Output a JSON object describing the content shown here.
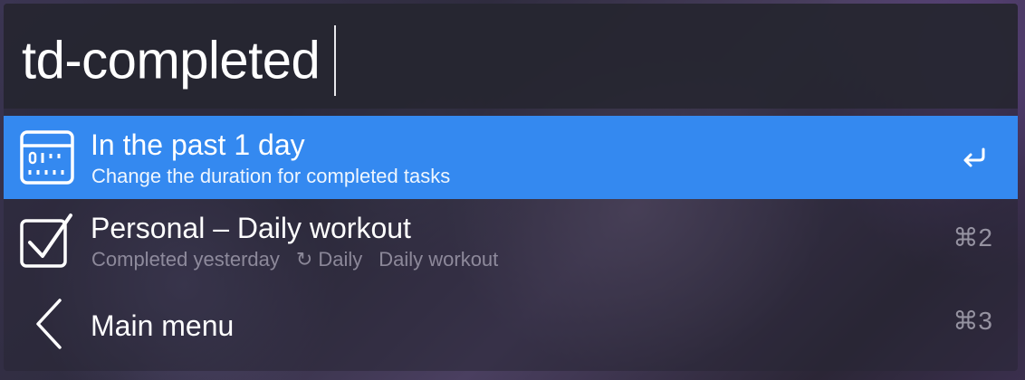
{
  "search": {
    "query": "td-completed"
  },
  "results": [
    {
      "title": "In the past 1 day",
      "subtitle": "Change the duration for completed tasks",
      "icon": "calendar-icon",
      "action": "enter-key-icon",
      "selected": true
    },
    {
      "title": "Personal – Daily workout",
      "meta": {
        "completed": "Completed yesterday",
        "recurrence_glyph": "↻",
        "recurrence": "Daily",
        "task": "Daily workout"
      },
      "icon": "checkbox-checked-icon",
      "shortcut": "⌘2"
    },
    {
      "title": "Main menu",
      "icon": "chevron-left-icon",
      "shortcut": "⌘3"
    }
  ],
  "colors": {
    "selected_row": "#3489f0",
    "text": "#ffffff",
    "dim_text": "#a9a6b4"
  }
}
